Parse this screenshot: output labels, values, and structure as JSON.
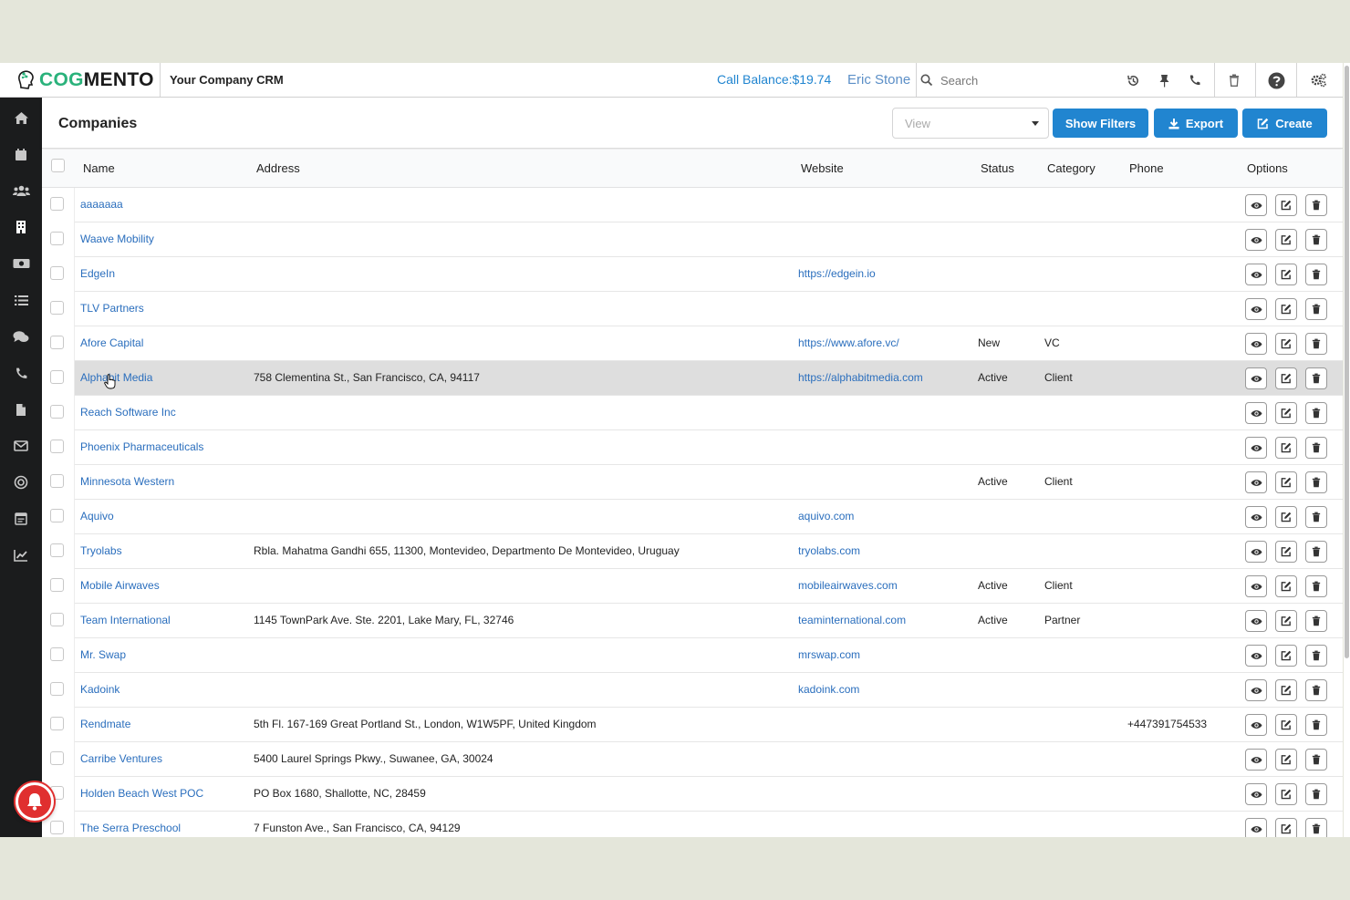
{
  "topbar": {
    "logo_text_primary": "COG",
    "logo_text_secondary": "MENTO",
    "company_name": "Your Company CRM",
    "call_balance": "Call Balance:$19.74",
    "user_name": "Eric Stone",
    "search_placeholder": "Search"
  },
  "header": {
    "title": "Companies",
    "view_placeholder": "View",
    "show_filters_label": "Show Filters",
    "export_label": "Export",
    "create_label": "Create"
  },
  "table": {
    "columns": [
      "Name",
      "Address",
      "Website",
      "Status",
      "Category",
      "Phone",
      "Options"
    ],
    "rows": [
      {
        "name": "aaaaaaa",
        "address": "",
        "website": "",
        "status": "",
        "category": "",
        "phone": ""
      },
      {
        "name": "Waave Mobility",
        "address": "",
        "website": "",
        "status": "",
        "category": "",
        "phone": ""
      },
      {
        "name": "EdgeIn",
        "address": "",
        "website": "https://edgein.io",
        "status": "",
        "category": "",
        "phone": ""
      },
      {
        "name": "TLV Partners",
        "address": "",
        "website": "",
        "status": "",
        "category": "",
        "phone": ""
      },
      {
        "name": "Afore Capital",
        "address": "",
        "website": "https://www.afore.vc/",
        "status": "New",
        "category": "VC",
        "phone": ""
      },
      {
        "name": "Alphabit Media",
        "address": "758 Clementina St., San Francisco, CA, 94117",
        "website": "https://alphabitmedia.com",
        "status": "Active",
        "category": "Client",
        "phone": ""
      },
      {
        "name": "Reach Software Inc",
        "address": "",
        "website": "",
        "status": "",
        "category": "",
        "phone": ""
      },
      {
        "name": "Phoenix Pharmaceuticals",
        "address": "",
        "website": "",
        "status": "",
        "category": "",
        "phone": ""
      },
      {
        "name": "Minnesota Western",
        "address": "",
        "website": "",
        "status": "Active",
        "category": "Client",
        "phone": ""
      },
      {
        "name": "Aquivo",
        "address": "",
        "website": "aquivo.com",
        "status": "",
        "category": "",
        "phone": ""
      },
      {
        "name": "Tryolabs",
        "address": "Rbla. Mahatma Gandhi 655, 11300, Montevideo, Departmento De Montevideo, Uruguay",
        "website": "tryolabs.com",
        "status": "",
        "category": "",
        "phone": ""
      },
      {
        "name": "Mobile Airwaves",
        "address": "",
        "website": "mobileairwaves.com",
        "status": "Active",
        "category": "Client",
        "phone": ""
      },
      {
        "name": "Team International",
        "address": "1145 TownPark Ave. Ste. 2201, Lake Mary, FL, 32746",
        "website": "teaminternational.com",
        "status": "Active",
        "category": "Partner",
        "phone": ""
      },
      {
        "name": "Mr. Swap",
        "address": "",
        "website": "mrswap.com",
        "status": "",
        "category": "",
        "phone": ""
      },
      {
        "name": "Kadoink",
        "address": "",
        "website": "kadoink.com",
        "status": "",
        "category": "",
        "phone": ""
      },
      {
        "name": "Rendmate",
        "address": "5th Fl. 167-169 Great Portland St., London, W1W5PF, United Kingdom",
        "website": "",
        "status": "",
        "category": "",
        "phone": "+447391754533"
      },
      {
        "name": "Carribe Ventures",
        "address": "5400 Laurel Springs Pkwy., Suwanee, GA, 30024",
        "website": "",
        "status": "",
        "category": "",
        "phone": ""
      },
      {
        "name": "Holden Beach West POC",
        "address": "PO Box 1680, Shallotte, NC, 28459",
        "website": "",
        "status": "",
        "category": "",
        "phone": ""
      },
      {
        "name": "The Serra Preschool",
        "address": "7 Funston Ave., San Francisco, CA, 94129",
        "website": "",
        "status": "",
        "category": "",
        "phone": ""
      }
    ]
  },
  "colors": {
    "accent": "#2185d0",
    "link": "#2a6ebd",
    "sidebar_bg": "#1b1c1d",
    "logo_green": "#2ab27b",
    "notification_red": "#e02f2f"
  },
  "sidebar_icons": [
    "home-icon",
    "calendar-icon",
    "contacts-icon",
    "companies-icon",
    "deals-icon",
    "tasks-icon",
    "cases-icon",
    "calls-icon",
    "documents-icon",
    "email-icon",
    "campaigns-icon",
    "forms-icon",
    "reports-icon"
  ]
}
